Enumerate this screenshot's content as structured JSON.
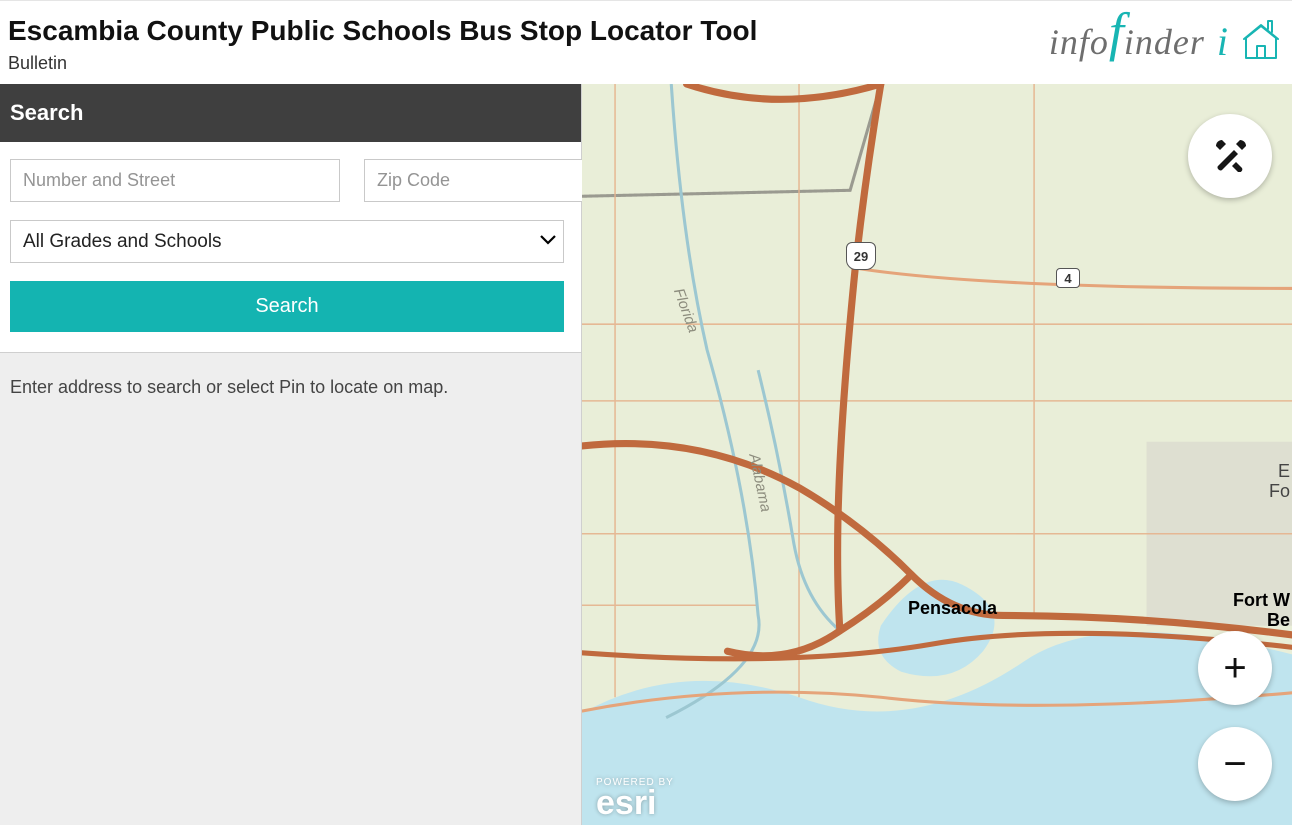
{
  "header": {
    "title": "Escambia County Public Schools Bus Stop Locator Tool",
    "subtitle": "Bulletin",
    "logo": {
      "part1": "info",
      "part2": "inder",
      "i": "i"
    }
  },
  "sidebar": {
    "title": "Search",
    "street_placeholder": "Number and Street",
    "zip_placeholder": "Zip Code",
    "grade_select": "All Grades and Schools",
    "search_button": "Search",
    "hint": "Enter address to search or select Pin to locate on map."
  },
  "map": {
    "labels": {
      "pensacola": "Pensacola",
      "fort_walton_line1": "Fort W",
      "fort_walton_line2": "Be",
      "eglin_line1": "E",
      "eglin_line2": "Fo",
      "florida_river": "Florida",
      "alabama_river": "Alabama"
    },
    "shields": {
      "us29": "29",
      "sr4": "4"
    },
    "attribution": {
      "powered_by": "POWERED BY",
      "brand": "esri"
    },
    "tools": {
      "zoom_in": "+",
      "zoom_out": "−"
    }
  }
}
